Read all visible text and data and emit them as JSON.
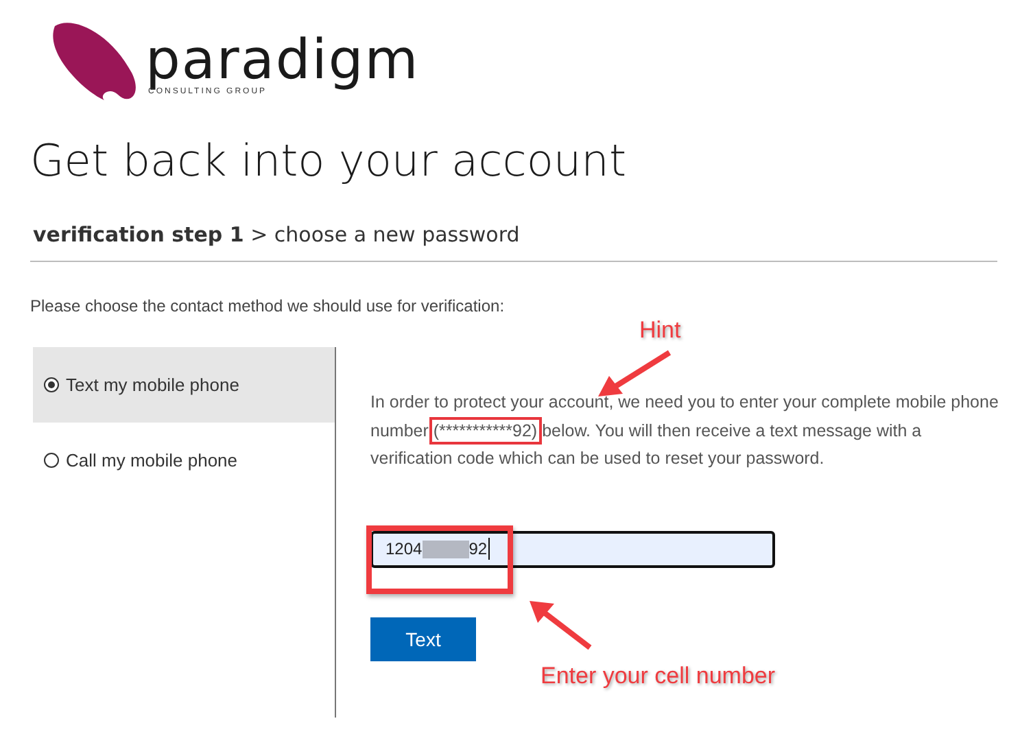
{
  "logo": {
    "name": "paradigm",
    "tagline": "CONSULTING GROUP"
  },
  "title": "Get back into your account",
  "breadcrumb": "**verification step 1** > choose a new password",
  "instruction": "Please choose the contact method we should use for verification:",
  "options": [
    {
      "label": "Text my mobile phone",
      "selected": true
    },
    {
      "label": "Call my mobile phone",
      "selected": false
    }
  ],
  "message": {
    "before": "In order to protect your account, we need you to enter your complete mobile phone number ",
    "highlight": "(***********92)",
    "after": " below. You will then receive a text message with a verification code which can be used to reset your password."
  },
  "phone_field": {
    "value_start": "1204",
    "value_end": "92"
  },
  "submit_button": "Text",
  "annotations": [
    {
      "label": "Hint"
    },
    {
      "label": "Enter your cell number"
    }
  ]
}
